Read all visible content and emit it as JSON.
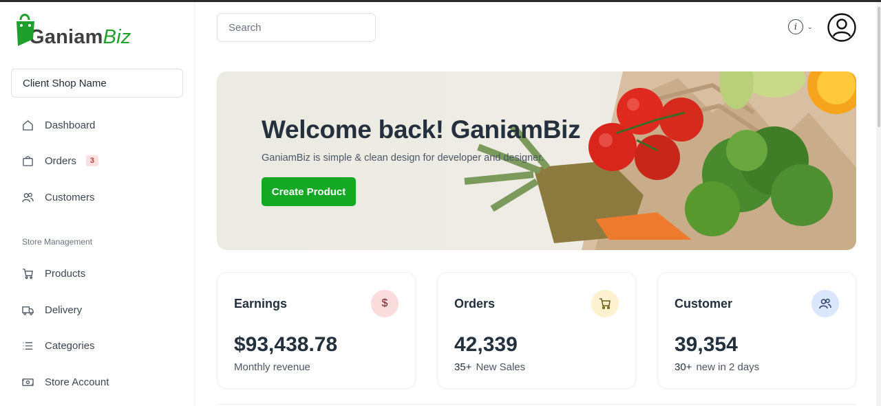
{
  "brand": {
    "name_main": "Ganiam",
    "name_accent": "Biz",
    "color": "#1fa02c"
  },
  "sidebar": {
    "shop_name": "Client Shop Name",
    "items": [
      {
        "label": "Dashboard",
        "icon": "home-icon"
      },
      {
        "label": "Orders",
        "icon": "bag-icon",
        "badge": "3"
      },
      {
        "label": "Customers",
        "icon": "users-icon"
      }
    ],
    "section_label": "Store Management",
    "store_items": [
      {
        "label": "Products",
        "icon": "cart-icon"
      },
      {
        "label": "Delivery",
        "icon": "truck-icon"
      },
      {
        "label": "Categories",
        "icon": "list-icon"
      },
      {
        "label": "Store Account",
        "icon": "money-icon"
      }
    ]
  },
  "header": {
    "search_placeholder": "Search",
    "info_icon": "info-icon",
    "avatar_icon": "user-circle-icon"
  },
  "banner": {
    "title": "Welcome back! GaniamBiz",
    "subtitle": "GaniamBiz is simple & clean design for developer and designer.",
    "cta_label": "Create Product"
  },
  "cards": [
    {
      "title": "Earnings",
      "value": "$93,438.78",
      "sub_count": "",
      "sub_text": "Monthly revenue",
      "icon": "dollar-icon",
      "icon_bg": "#fbdcdc"
    },
    {
      "title": "Orders",
      "value": "42,339",
      "sub_count": "35+",
      "sub_text": "New Sales",
      "icon": "cart-icon",
      "icon_bg": "#fdf1cf"
    },
    {
      "title": "Customer",
      "value": "39,354",
      "sub_count": "30+",
      "sub_text": "new in 2 days",
      "icon": "users-icon",
      "icon_bg": "#d9e6fb"
    }
  ],
  "colors": {
    "accent_green": "#14a825",
    "text_dark": "#24303d"
  }
}
